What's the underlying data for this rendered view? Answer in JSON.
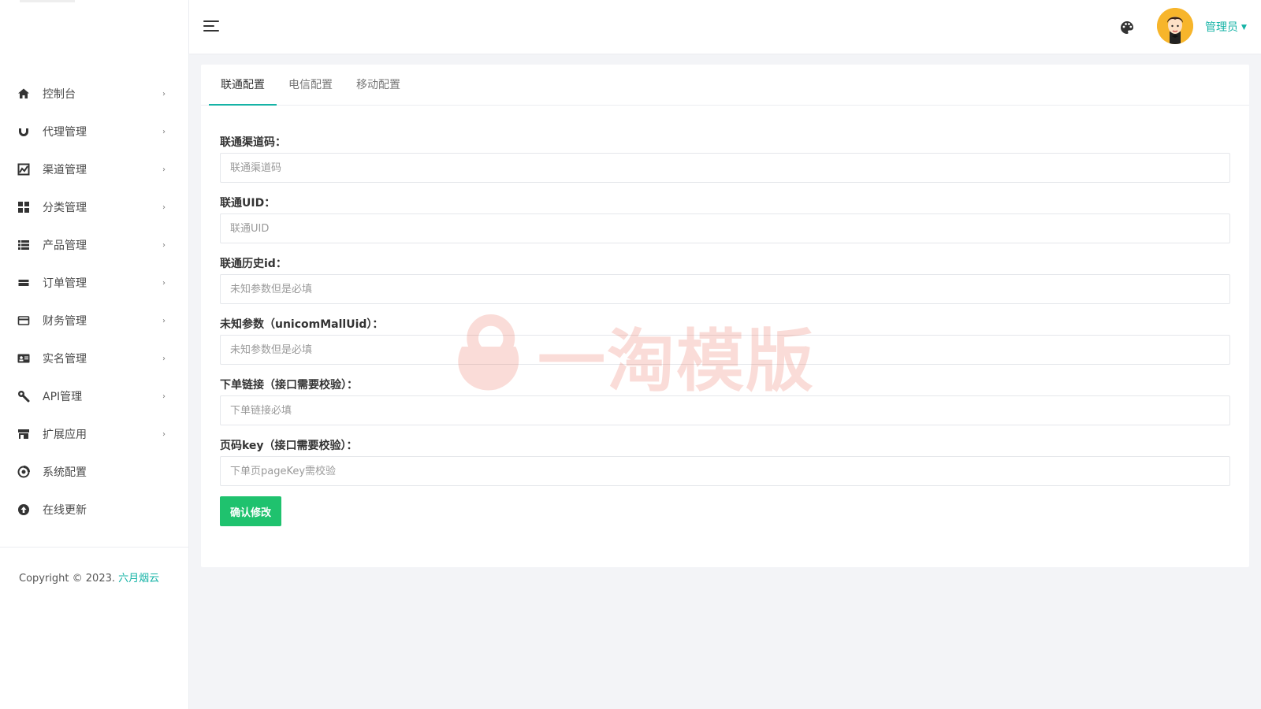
{
  "sidebar": {
    "items": [
      {
        "label": "控制台",
        "icon": "home-icon"
      },
      {
        "label": "代理管理",
        "icon": "magnet-icon"
      },
      {
        "label": "渠道管理",
        "icon": "chart-icon"
      },
      {
        "label": "分类管理",
        "icon": "grid-icon"
      },
      {
        "label": "产品管理",
        "icon": "list-icon"
      },
      {
        "label": "订单管理",
        "icon": "order-icon"
      },
      {
        "label": "财务管理",
        "icon": "card-icon"
      },
      {
        "label": "实名管理",
        "icon": "id-card-icon"
      },
      {
        "label": "API管理",
        "icon": "wrench-icon"
      },
      {
        "label": "扩展应用",
        "icon": "store-icon"
      },
      {
        "label": "系统配置",
        "icon": "settings-icon"
      },
      {
        "label": "在线更新",
        "icon": "upload-icon"
      }
    ],
    "copyright_prefix": "Copyright © 2023.",
    "copyright_link": "六月烟云"
  },
  "header": {
    "user_name": "管理员"
  },
  "tabs": [
    {
      "label": "联通配置",
      "active": true
    },
    {
      "label": "电信配置",
      "active": false
    },
    {
      "label": "移动配置",
      "active": false
    }
  ],
  "form": {
    "fields": [
      {
        "label": "联通渠道码：",
        "placeholder": "联通渠道码",
        "value": ""
      },
      {
        "label": "联通UID：",
        "placeholder": "联通UID",
        "value": ""
      },
      {
        "label": "联通历史id：",
        "placeholder": "未知参数但是必填",
        "value": ""
      },
      {
        "label": "未知参数（unicomMallUid）：",
        "placeholder": "未知参数但是必填",
        "value": ""
      },
      {
        "label": "下单链接（接口需要校验）：",
        "placeholder": "下单链接必填",
        "value": ""
      },
      {
        "label": "页码key（接口需要校验）：",
        "placeholder": "下单页pageKey需校验",
        "value": ""
      }
    ],
    "submit_label": "确认修改"
  },
  "watermark": {
    "text": "一淘模版"
  },
  "colors": {
    "accent": "#15b3a6",
    "submit": "#1fc26e",
    "watermark": "#e8452c"
  }
}
